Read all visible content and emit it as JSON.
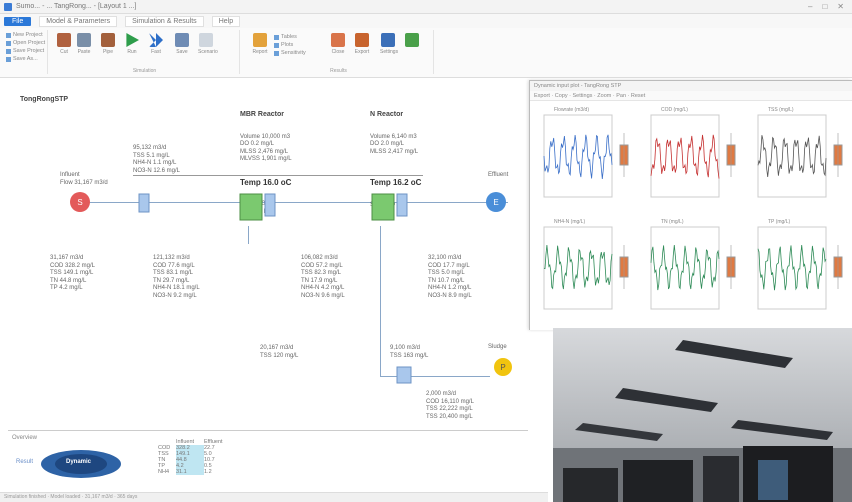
{
  "window": {
    "title": "Sumo... - ... TangRong... - [Layout 1 ...]"
  },
  "menu": {
    "file": "File",
    "items": [
      "Model & Parameters",
      "Simulation & Results",
      "Help"
    ]
  },
  "ribbon": {
    "small_cmds": [
      "New Project",
      "Open Project",
      "Save Project",
      "Save As..."
    ],
    "buttons": [
      "Cut",
      "Paste",
      "Pipe",
      "Run",
      "Fast",
      "Save",
      "Scenario",
      "Report",
      "Tables",
      "Plots",
      "Sensitivity",
      "Close",
      "Export",
      "Settings"
    ],
    "group_labels": [
      "Project",
      "Simulation",
      "Results"
    ]
  },
  "flowsheet": {
    "plant_name": "TongRongSTP",
    "influent": {
      "label": "Influent",
      "flow": "Flow 31,167 m3/d",
      "lines": [
        "31,167 m3/d",
        "COD 328.2 mg/L",
        "TSS 149.1 mg/L",
        "TN 44.8 mg/L",
        "TP 4.2 mg/L"
      ]
    },
    "pipe_upper": [
      "95,132 m3/d",
      "TSS 5.1 mg/L",
      "NH4-N 1.1 mg/L",
      "NO3-N 12.6 mg/L"
    ],
    "pipe_mid1": [
      "121,132 m3/d",
      "COD 77.6 mg/L",
      "TSS 83.1 mg/L",
      "TN 29.7 mg/L",
      "NH4-N 18.1 mg/L",
      "NO3-N 9.2 mg/L"
    ],
    "reactor1": {
      "title": "MBR Reactor",
      "lines": [
        "Volume 10,000 m3",
        "DO 0.2 mg/L",
        "MLSS 2,476 mg/L",
        "MLVSS 1,901 mg/L"
      ],
      "temp": "Temp 16.0 oC",
      "rates": [
        "SRT 15.0 d",
        "HRT 6.1 h"
      ]
    },
    "reactor2": {
      "title": "N Reactor",
      "lines": [
        "Volume 6,140 m3",
        "DO 2.0 mg/L",
        "MLSS 2,417 mg/L"
      ],
      "temp": "Temp 16.2 oC",
      "rates": [
        "SRT 15.0 d"
      ]
    },
    "pipe_mid2": [
      "106,082 m3/d",
      "COD 57.2 mg/L",
      "TSS 82.3 mg/L",
      "TN 17.9 mg/L",
      "NH4-N 4.2 mg/L",
      "NO3-N 9.6 mg/L"
    ],
    "pipe_right": [
      "32,100 m3/d",
      "COD 17.7 mg/L",
      "TSS 5.0 mg/L",
      "TN 10.7 mg/L",
      "NH4-N 1.2 mg/L",
      "NO3-N 8.9 mg/L"
    ],
    "effluent": {
      "label": "Effluent",
      "lines": [
        "Effluent"
      ]
    },
    "recycle": [
      "20,167 m3/d",
      "TSS 120 mg/L"
    ],
    "was": [
      "9,100 m3/d",
      "TSS 163 mg/L"
    ],
    "sludge": {
      "label": "Sludge",
      "lines": [
        "2,000 m3/d",
        "COD 16,110 mg/L",
        "TSS 22,222 mg/L",
        "TSS 20,400 mg/L"
      ]
    }
  },
  "bottom": {
    "title": "Overview",
    "badge": "Dynamic",
    "left_label": "Result",
    "table_headers": [
      "",
      "Influent",
      "Effluent"
    ],
    "table_rows": [
      [
        "COD",
        "328.2",
        "22.7"
      ],
      [
        "TSS",
        "149.1",
        "5.0"
      ],
      [
        "TN",
        "44.8",
        "10.7"
      ],
      [
        "TP",
        "4.2",
        "0.5"
      ],
      [
        "NH4",
        "31.1",
        "1.2"
      ]
    ]
  },
  "status": {
    "text": "Simulation finished · Model loaded · 31,167 m3/d · 365 days"
  },
  "plots": {
    "title": "Dynamic input plot - TangRong STP",
    "toolbar": "Export · Copy · Settings · Zoom · Pan · Reset",
    "panels": [
      {
        "title": "Flowrate (m3/d)",
        "color": "#3a6fc8"
      },
      {
        "title": "COD (mg/L)",
        "color": "#c53030"
      },
      {
        "title": "TSS (mg/L)",
        "color": "#555555"
      },
      {
        "title": "NH4-N (mg/L)",
        "color": "#2e8b57"
      },
      {
        "title": "TN (mg/L)",
        "color": "#2e8b57"
      },
      {
        "title": "TP (mg/L)",
        "color": "#2e8b57"
      }
    ]
  },
  "colors": {
    "accent": "#2b78d8",
    "influent": "#e35a5a",
    "effluent": "#4a8ed8",
    "sludge": "#f1c40f",
    "tank": "#7bc96f"
  }
}
